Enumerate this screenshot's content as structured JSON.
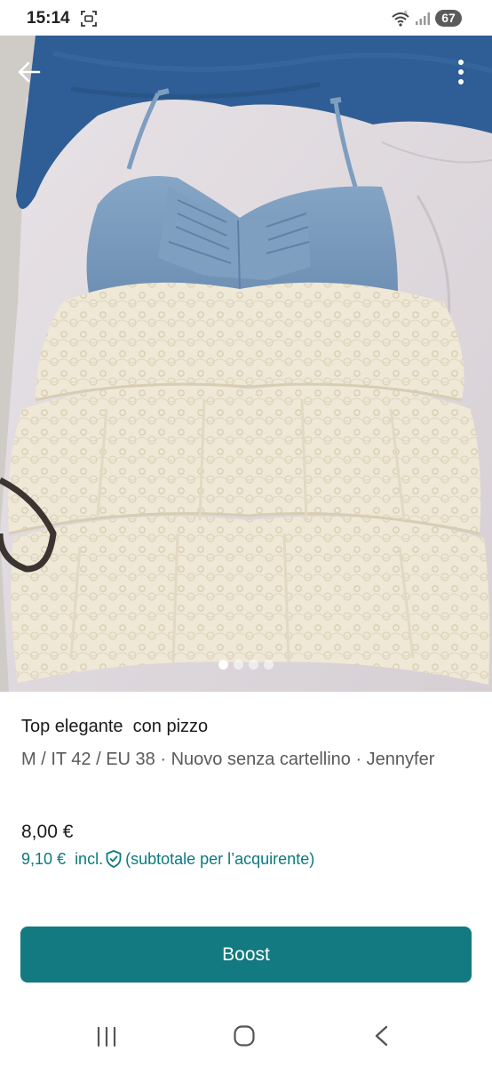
{
  "status_bar": {
    "time": "15:14",
    "battery": "67",
    "icons": [
      "screenshot-icon",
      "wifi-icon",
      "signal-icon"
    ]
  },
  "photo": {
    "page_index": 1,
    "page_count": 4
  },
  "listing": {
    "title": "Top elegante  con pizzo",
    "meta": "M / IT 42 / EU 38 · Nuovo senza cartellino · Jennyfer",
    "price": "8,00 €",
    "price_with_fee": "9,10 €",
    "incl_label": "incl.",
    "fee_note": "(subtotale per l’acquirente)"
  },
  "boost_button": {
    "label": "Boost"
  },
  "colors": {
    "accent": "#127a80",
    "accent_text": "#0a7a7e",
    "text_primary": "#1a1a1a",
    "text_secondary": "#5a5a5a"
  }
}
